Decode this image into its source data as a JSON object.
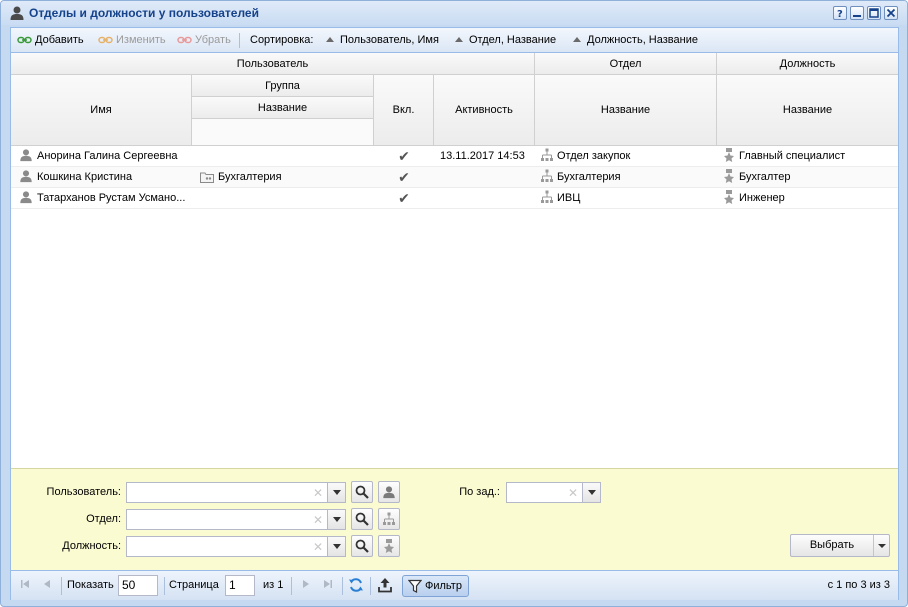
{
  "window": {
    "title": "Отделы и должности у пользователей"
  },
  "toolbar": {
    "add": "Добавить",
    "edit": "Изменить",
    "remove": "Убрать",
    "sort_label": "Сортировка:",
    "sort_user": "Пользователь, Имя",
    "sort_dept": "Отдел, Название",
    "sort_pos": "Должность, Название"
  },
  "columns": {
    "user": "Пользователь",
    "dept": "Отдел",
    "pos": "Должность",
    "name": "Имя",
    "group": "Группа",
    "group_name": "Название",
    "enabled": "Вкл.",
    "activity": "Активность",
    "dept_name": "Название",
    "pos_name": "Название"
  },
  "rows": [
    {
      "name": "Анорина Галина Сергеевна",
      "group": "",
      "enabled": "✔",
      "activity": "13.11.2017 14:53",
      "dept": "Отдел закупок",
      "pos": "Главный специалист"
    },
    {
      "name": "Кошкина Кристина",
      "group": "Бухгалтерия",
      "enabled": "✔",
      "activity": "",
      "dept": "Бухгалтерия",
      "pos": "Бухгалтер"
    },
    {
      "name": "Татарханов Рустам Усмано...",
      "group": "",
      "enabled": "✔",
      "activity": "",
      "dept": "ИВЦ",
      "pos": "Инженер"
    }
  ],
  "filter": {
    "user_label": "Пользователь:",
    "dept_label": "Отдел:",
    "pos_label": "Должность:",
    "task_label": "По зад.:",
    "select_button": "Выбрать"
  },
  "paging": {
    "show_label": "Показать",
    "page_size": "50",
    "page_label": "Страница",
    "page_value": "1",
    "of_pages": "из 1",
    "filter_button": "Фильтр",
    "summary": "с 1 по 3 из 3"
  },
  "colors": {
    "title_text": "#15428b",
    "filter_bg": "#fbfbd2",
    "border": "#99bbe8"
  }
}
